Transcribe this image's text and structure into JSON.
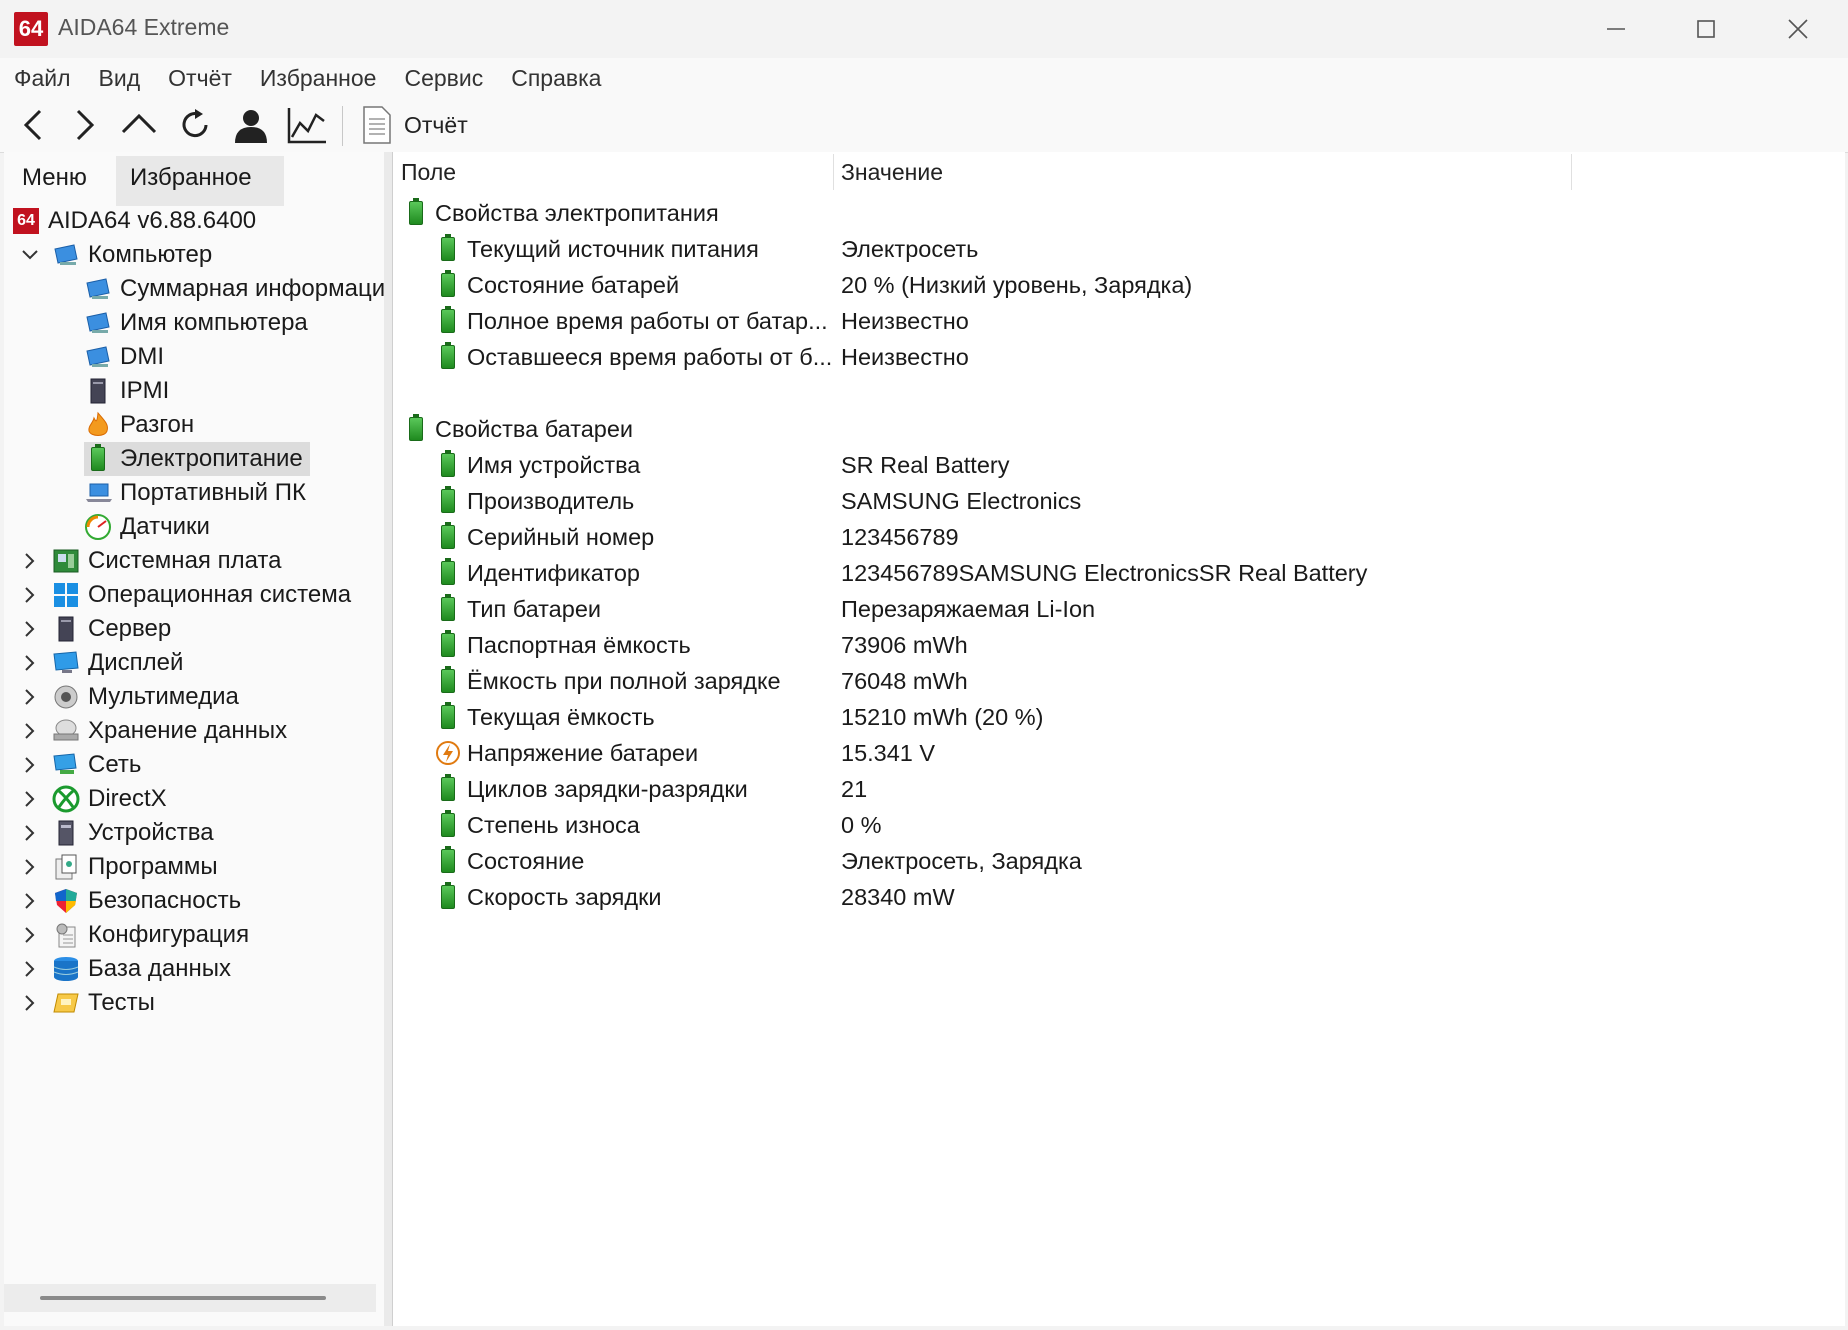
{
  "window": {
    "title": "AIDA64 Extreme",
    "logo_text": "64"
  },
  "menu": [
    "Файл",
    "Вид",
    "Отчёт",
    "Избранное",
    "Сервис",
    "Справка"
  ],
  "toolbar": {
    "report_label": "Отчёт"
  },
  "left_tabs": {
    "menu": "Меню",
    "favorites": "Избранное"
  },
  "tree": {
    "root": "AIDA64 v6.88.6400",
    "computer": "Компьютер",
    "computer_children": [
      "Суммарная информаци",
      "Имя компьютера",
      "DMI",
      "IPMI",
      "Разгон",
      "Электропитание",
      "Портативный ПК",
      "Датчики"
    ],
    "sections": [
      "Системная плата",
      "Операционная система",
      "Сервер",
      "Дисплей",
      "Мультимедиа",
      "Хранение данных",
      "Сеть",
      "DirectX",
      "Устройства",
      "Программы",
      "Безопасность",
      "Конфигурация",
      "База данных",
      "Тесты"
    ]
  },
  "columns": {
    "field": "Поле",
    "value": "Значение"
  },
  "groups": [
    {
      "title": "Свойства электропитания",
      "rows": [
        {
          "field": "Текущий источник питания",
          "value": "Электросеть"
        },
        {
          "field": "Состояние батарей",
          "value": "20 % (Низкий уровень, Зарядка)"
        },
        {
          "field": "Полное время работы от батар...",
          "value": "Неизвестно"
        },
        {
          "field": "Оставшееся время работы от б...",
          "value": "Неизвестно"
        }
      ]
    },
    {
      "title": "Свойства батареи",
      "rows": [
        {
          "field": "Имя устройства",
          "value": "SR Real Battery"
        },
        {
          "field": "Производитель",
          "value": "SAMSUNG Electronics"
        },
        {
          "field": "Серийный номер",
          "value": "123456789"
        },
        {
          "field": "Идентификатор",
          "value": "123456789SAMSUNG ElectronicsSR Real Battery"
        },
        {
          "field": "Тип батареи",
          "value": "Перезаряжаемая Li-Ion"
        },
        {
          "field": "Паспортная ёмкость",
          "value": "73906 mWh"
        },
        {
          "field": "Ёмкость при полной зарядке",
          "value": "76048 mWh"
        },
        {
          "field": "Текущая ёмкость",
          "value": "15210 mWh  (20 %)"
        },
        {
          "field": "Напряжение батареи",
          "value": "15.341 V"
        },
        {
          "field": "Циклов зарядки-разрядки",
          "value": "21"
        },
        {
          "field": "Степень износа",
          "value": "0 %"
        },
        {
          "field": "Состояние",
          "value": "Электросеть, Зарядка"
        },
        {
          "field": "Скорость зарядки",
          "value": "28340 mW"
        }
      ]
    }
  ]
}
